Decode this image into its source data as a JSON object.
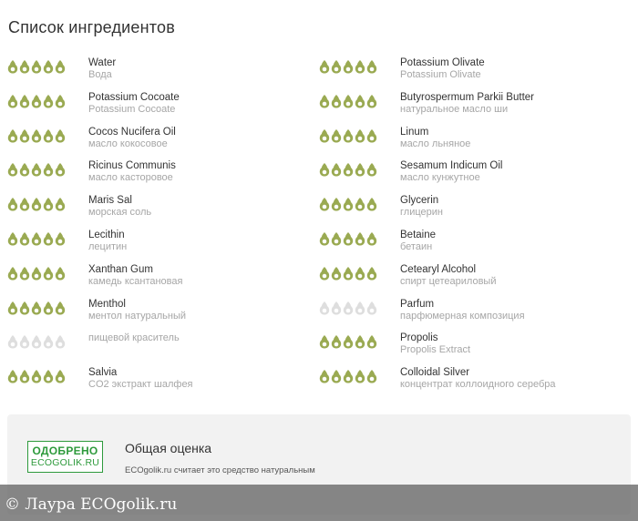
{
  "page_title": "Список ингредиентов",
  "colors": {
    "good": "#9aaa52",
    "neutral": "#dedede"
  },
  "left_column": [
    {
      "name": "Water",
      "sub": "Вода",
      "rating": "good"
    },
    {
      "name": "Potassium Cocoate",
      "sub": "Potassium Cocoate",
      "rating": "good"
    },
    {
      "name": "Cocos Nucifera Oil",
      "sub": "масло кокосовое",
      "rating": "good"
    },
    {
      "name": "Ricinus Communis",
      "sub": "масло касторовое",
      "rating": "good"
    },
    {
      "name": "Maris Sal",
      "sub": "морская соль",
      "rating": "good"
    },
    {
      "name": "Lecithin",
      "sub": "лецитин",
      "rating": "good"
    },
    {
      "name": "Xanthan Gum",
      "sub": "камедь ксантановая",
      "rating": "good"
    },
    {
      "name": "Menthol",
      "sub": "ментол натуральный",
      "rating": "good"
    },
    {
      "name": "",
      "sub": "пищевой краситель",
      "rating": "neutral"
    },
    {
      "name": "Salvia",
      "sub": "CO2 экстракт шалфея",
      "rating": "good"
    }
  ],
  "right_column": [
    {
      "name": "Potassium Olivate",
      "sub": "Potassium Olivate",
      "rating": "good"
    },
    {
      "name": "Butyrospermum Parkii Butter",
      "sub": "натуральное масло ши",
      "rating": "good"
    },
    {
      "name": "Linum",
      "sub": "масло льняное",
      "rating": "good"
    },
    {
      "name": "Sesamum Indicum Oil",
      "sub": "масло кунжутное",
      "rating": "good"
    },
    {
      "name": "Glycerin",
      "sub": "глицерин",
      "rating": "good"
    },
    {
      "name": "Betaine",
      "sub": "бетаин",
      "rating": "good"
    },
    {
      "name": "Cetearyl Alcohol",
      "sub": "спирт цетеариловый",
      "rating": "good"
    },
    {
      "name": "Parfum",
      "sub": "парфюмерная композиция",
      "rating": "neutral"
    },
    {
      "name": "Propolis",
      "sub": "Propolis Extract",
      "rating": "good"
    },
    {
      "name": "Colloidal Silver",
      "sub": "концентрат коллоидного серебра",
      "rating": "good"
    }
  ],
  "summary": {
    "badge_line1": "ОДОБРЕНО",
    "badge_line2": "ECOGOLIK.RU",
    "title": "Общая оценка",
    "text": "ECOgolik.ru считает это средство натуральным"
  },
  "watermark": "© Лаура ECOgolik.ru"
}
